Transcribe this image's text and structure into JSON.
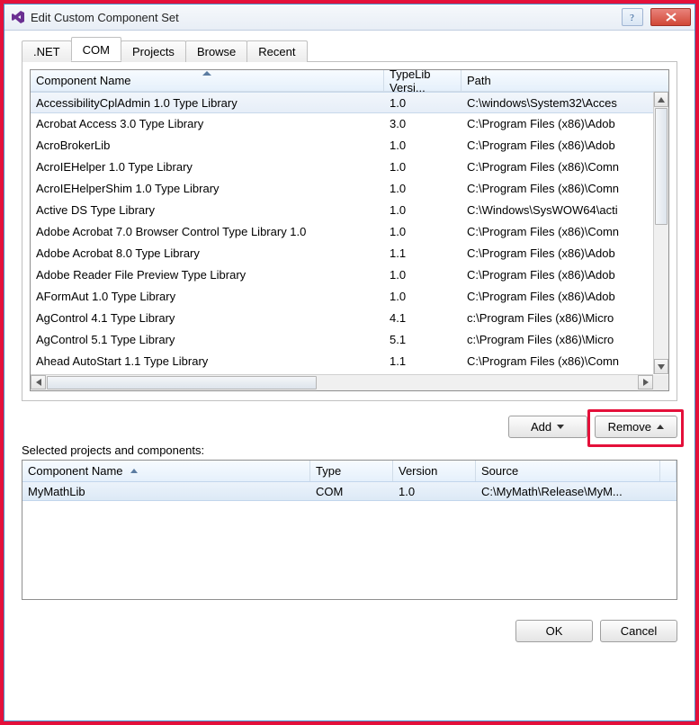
{
  "window": {
    "title": "Edit Custom Component Set"
  },
  "tabs": {
    "net": ".NET",
    "com": "COM",
    "projects": "Projects",
    "browse": "Browse",
    "recent": "Recent"
  },
  "upper": {
    "columns": {
      "name": "Component Name",
      "version": "TypeLib Versi...",
      "path": "Path"
    },
    "rows": [
      {
        "name": "AccessibilityCplAdmin 1.0 Type Library",
        "version": "1.0",
        "path": "C:\\windows\\System32\\Acces"
      },
      {
        "name": "Acrobat Access 3.0 Type Library",
        "version": "3.0",
        "path": "C:\\Program Files (x86)\\Adob"
      },
      {
        "name": "AcroBrokerLib",
        "version": "1.0",
        "path": "C:\\Program Files (x86)\\Adob"
      },
      {
        "name": "AcroIEHelper 1.0 Type Library",
        "version": "1.0",
        "path": "C:\\Program Files (x86)\\Comn"
      },
      {
        "name": "AcroIEHelperShim 1.0 Type Library",
        "version": "1.0",
        "path": "C:\\Program Files (x86)\\Comn"
      },
      {
        "name": "Active DS Type Library",
        "version": "1.0",
        "path": "C:\\Windows\\SysWOW64\\acti"
      },
      {
        "name": "Adobe Acrobat 7.0 Browser Control Type Library 1.0",
        "version": "1.0",
        "path": "C:\\Program Files (x86)\\Comn"
      },
      {
        "name": "Adobe Acrobat 8.0 Type Library",
        "version": "1.1",
        "path": "C:\\Program Files (x86)\\Adob"
      },
      {
        "name": "Adobe Reader File Preview Type Library",
        "version": "1.0",
        "path": "C:\\Program Files (x86)\\Adob"
      },
      {
        "name": "AFormAut 1.0 Type Library",
        "version": "1.0",
        "path": "C:\\Program Files (x86)\\Adob"
      },
      {
        "name": "AgControl 4.1 Type Library",
        "version": "4.1",
        "path": "c:\\Program Files (x86)\\Micro"
      },
      {
        "name": "AgControl 5.1 Type Library",
        "version": "5.1",
        "path": "c:\\Program Files (x86)\\Micro"
      },
      {
        "name": "Ahead AutoStart 1.1 Type Library",
        "version": "1.1",
        "path": "C:\\Program Files (x86)\\Comn"
      }
    ]
  },
  "actions": {
    "add": "Add",
    "remove": "Remove"
  },
  "selected_label": "Selected projects and components:",
  "lower": {
    "columns": {
      "name": "Component Name",
      "type": "Type",
      "version": "Version",
      "source": "Source"
    },
    "rows": [
      {
        "name": "MyMathLib",
        "type": "COM",
        "version": "1.0",
        "source": "C:\\MyMath\\Release\\MyM..."
      }
    ]
  },
  "dlg": {
    "ok": "OK",
    "cancel": "Cancel"
  }
}
